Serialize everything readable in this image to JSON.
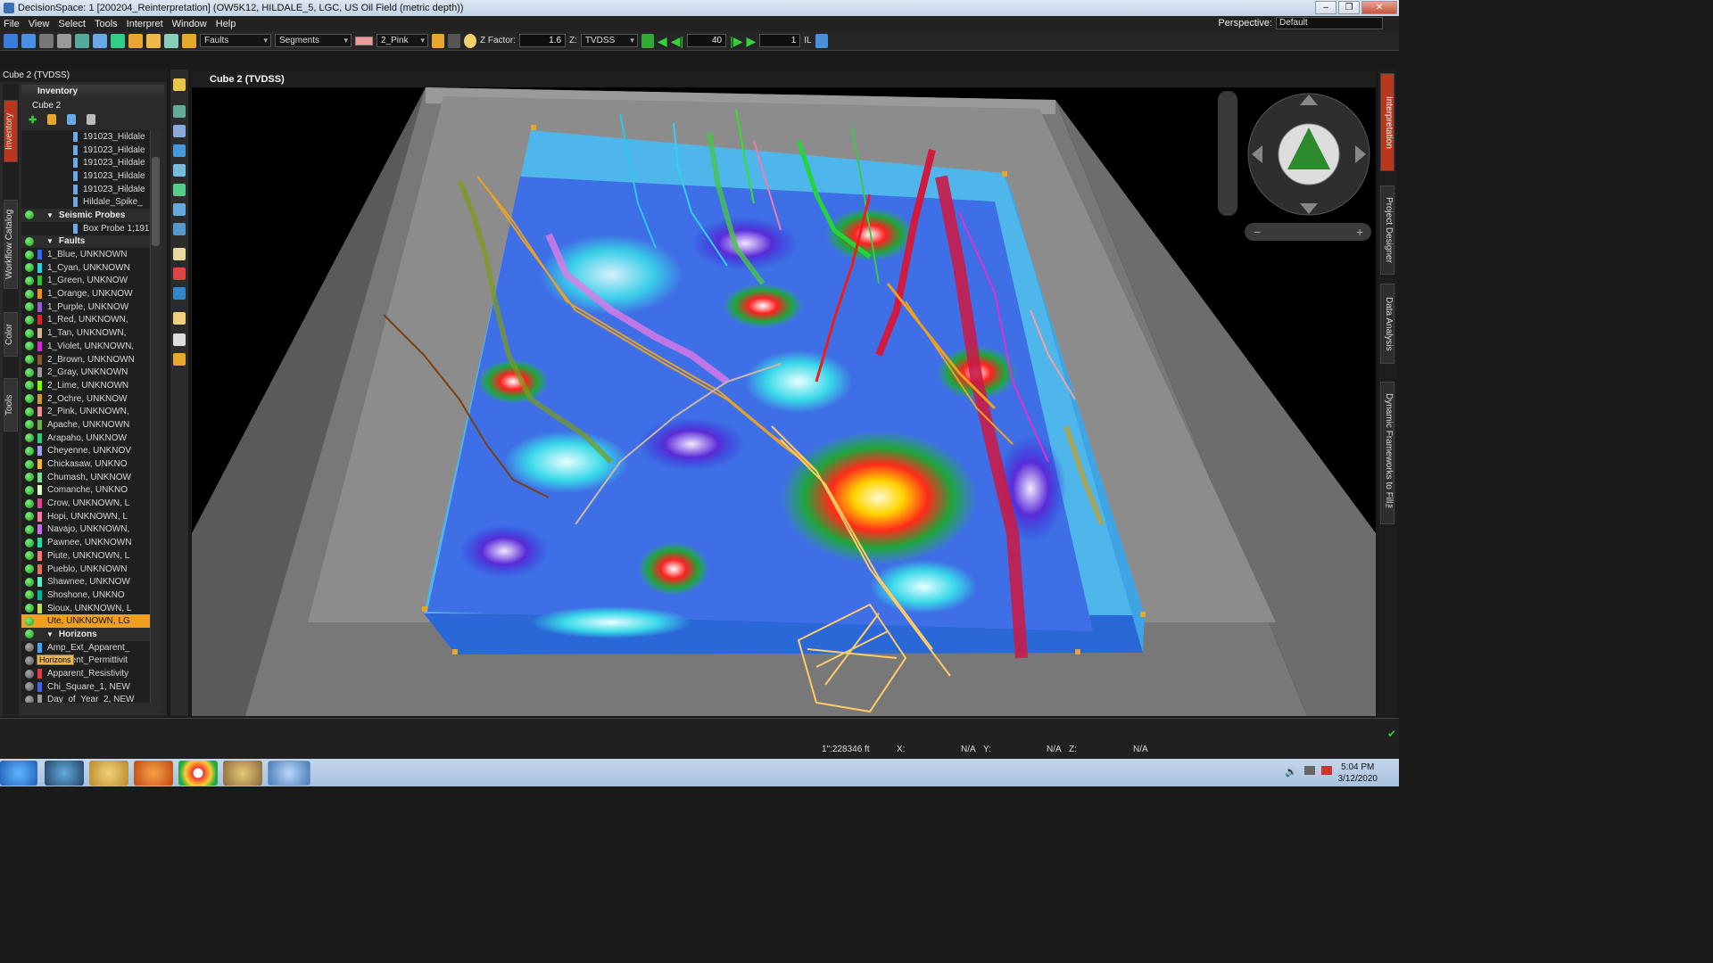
{
  "window": {
    "title": "DecisionSpace: 1 [200204_Reinterpretation] (OW5K12, HILDALE_5, LGC, US Oil Field (metric depth))"
  },
  "menu": {
    "items": [
      "File",
      "View",
      "Select",
      "Tools",
      "Interpret",
      "Window",
      "Help"
    ],
    "perspective_label": "Perspective:",
    "perspective_value": "Default"
  },
  "toolbar": {
    "object_type": "Faults",
    "mode": "Segments",
    "fault_name": "2_Pink",
    "zfactor_label": "Z Factor:",
    "zfactor": "1.6",
    "z_label": "Z:",
    "z_domain": "TVDSS",
    "step": "40",
    "frame": "1",
    "il_label": "IL"
  },
  "left": {
    "panel_title": "Cube 2 (TVDSS)",
    "tabs": [
      "Inventory",
      "Workflow Catalog",
      "Color",
      "Tools"
    ],
    "inventory_title": "Inventory",
    "root": "Cube 2",
    "tooltip": "Horizons",
    "tree": [
      {
        "t": "item",
        "label": "191023_Hildale"
      },
      {
        "t": "item",
        "label": "191023_Hildale"
      },
      {
        "t": "item",
        "label": "191023_Hildale"
      },
      {
        "t": "item",
        "label": "191023_Hildale"
      },
      {
        "t": "item",
        "label": "191023_Hildale"
      },
      {
        "t": "item",
        "label": "Hildale_Spike_"
      },
      {
        "t": "sec",
        "label": "Seismic Probes"
      },
      {
        "t": "item",
        "label": "Box Probe 1;191("
      },
      {
        "t": "sec",
        "label": "Faults"
      },
      {
        "t": "f",
        "label": "1_Blue, UNKNOWN",
        "c": "#2f6cf0"
      },
      {
        "t": "f",
        "label": "1_Cyan, UNKNOWN",
        "c": "#22d6e6"
      },
      {
        "t": "f",
        "label": "1_Green, UNKNOW",
        "c": "#2ec42e"
      },
      {
        "t": "f",
        "label": "1_Orange, UNKNOW",
        "c": "#f09020"
      },
      {
        "t": "f",
        "label": "1_Purple, UNKNOW",
        "c": "#9b59d6"
      },
      {
        "t": "f",
        "label": "1_Red, UNKNOWN,",
        "c": "#e02020"
      },
      {
        "t": "f",
        "label": "1_Tan, UNKNOWN,",
        "c": "#d2b48c"
      },
      {
        "t": "f",
        "label": "1_Violet, UNKNOWN,",
        "c": "#e020e0"
      },
      {
        "t": "f",
        "label": "2_Brown, UNKNOWN",
        "c": "#8b5a2b"
      },
      {
        "t": "f",
        "label": "2_Gray, UNKNOWN",
        "c": "#999999"
      },
      {
        "t": "f",
        "label": "2_Lime, UNKNOWN",
        "c": "#7cfc00"
      },
      {
        "t": "f",
        "label": "2_Ochre, UNKNOW",
        "c": "#cc9933"
      },
      {
        "t": "f",
        "label": "2_Pink, UNKNOWN,",
        "c": "#f08f8f"
      },
      {
        "t": "f",
        "label": "Apache, UNKNOWN",
        "c": "#6ab04c"
      },
      {
        "t": "f",
        "label": "Arapaho, UNKNOW",
        "c": "#2ecc71"
      },
      {
        "t": "f",
        "label": "Cheyenne, UNKNOV",
        "c": "#a29bfe"
      },
      {
        "t": "f",
        "label": "Chickasaw, UNKNO",
        "c": "#f6b93b"
      },
      {
        "t": "f",
        "label": "Chumash, UNKNOW",
        "c": "#78e08f"
      },
      {
        "t": "f",
        "label": "Comanche, UNKNO",
        "c": "#dff9c4"
      },
      {
        "t": "f",
        "label": "Crow, UNKNOWN, L",
        "c": "#e84393"
      },
      {
        "t": "f",
        "label": "Hopi, UNKNOWN, L",
        "c": "#fd79a8"
      },
      {
        "t": "f",
        "label": "Navajo, UNKNOWN,",
        "c": "#c56cf0"
      },
      {
        "t": "f",
        "label": "Pawnee, UNKNOWN",
        "c": "#17e3a0"
      },
      {
        "t": "f",
        "label": "Piute, UNKNOWN, L",
        "c": "#ff7675"
      },
      {
        "t": "f",
        "label": "Pueblo, UNKNOWN",
        "c": "#e17055"
      },
      {
        "t": "f",
        "label": "Shawnee, UNKNOW",
        "c": "#55efc4"
      },
      {
        "t": "f",
        "label": "Shoshone, UNKNO",
        "c": "#00b894"
      },
      {
        "t": "f",
        "label": "Sioux, UNKNOWN, L",
        "c": "#badc58"
      },
      {
        "t": "sel",
        "label": "Ute, UNKNOWN, LG",
        "c": "#f0a020"
      },
      {
        "t": "sec",
        "label": "Horizons"
      },
      {
        "t": "h",
        "label": "Amp_Ext_Apparent_",
        "c": "#3fa7ff"
      },
      {
        "t": "h",
        "label": "Apparent_Permittivit",
        "c": "#2ec4b6"
      },
      {
        "t": "h",
        "label": "Apparent_Resistivity",
        "c": "#e63946"
      },
      {
        "t": "h",
        "label": "Chi_Square_1, NEW",
        "c": "#4361ee"
      },
      {
        "t": "h",
        "label": "Day_of_Year_2, NEW",
        "c": "#999999"
      }
    ]
  },
  "viewer": {
    "title": "Cube 2 (TVDSS)"
  },
  "right_tabs": [
    "Interpretation",
    "Project Designer",
    "Data Analysis",
    "Dynamic Frameworks to Fill™"
  ],
  "status": {
    "scale": "1\":228346 ft",
    "x_label": "X:",
    "x": "N/A",
    "y_label": "Y:",
    "y": "N/A",
    "z_label": "Z:",
    "z": "N/A"
  },
  "taskbar": {
    "time": "5:04 PM",
    "date": "3/12/2020"
  }
}
